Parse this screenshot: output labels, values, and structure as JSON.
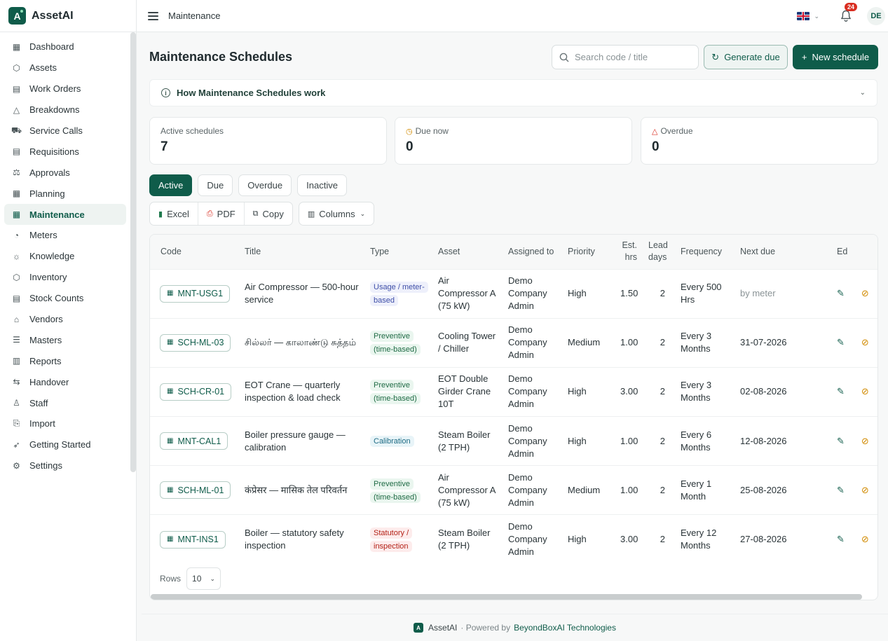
{
  "app": {
    "name": "AssetAI",
    "logo_letter": "A"
  },
  "topbar": {
    "title": "Maintenance",
    "notifications": "24",
    "avatar": "DE",
    "language_icon": "uk-flag-icon"
  },
  "sidebar": {
    "items": [
      {
        "label": "Dashboard",
        "icon": "dashboard-icon",
        "glyph": "▦"
      },
      {
        "label": "Assets",
        "icon": "box-icon",
        "glyph": "⬡"
      },
      {
        "label": "Work Orders",
        "icon": "clipboard-icon",
        "glyph": "▤"
      },
      {
        "label": "Breakdowns",
        "icon": "warning-icon",
        "glyph": "△"
      },
      {
        "label": "Service Calls",
        "icon": "truck-icon",
        "glyph": "⛟"
      },
      {
        "label": "Requisitions",
        "icon": "clipboard-check-icon",
        "glyph": "▤"
      },
      {
        "label": "Approvals",
        "icon": "gavel-icon",
        "glyph": "⚖"
      },
      {
        "label": "Planning",
        "icon": "calendar-icon",
        "glyph": "▦"
      },
      {
        "label": "Maintenance",
        "icon": "calendar-wrench-icon",
        "glyph": "▦"
      },
      {
        "label": "Meters",
        "icon": "gauge-icon",
        "glyph": "◔"
      },
      {
        "label": "Knowledge",
        "icon": "lightbulb-icon",
        "glyph": "☼"
      },
      {
        "label": "Inventory",
        "icon": "boxes-icon",
        "glyph": "⬡"
      },
      {
        "label": "Stock Counts",
        "icon": "clipboard-list-icon",
        "glyph": "▤"
      },
      {
        "label": "Vendors",
        "icon": "store-icon",
        "glyph": "⌂"
      },
      {
        "label": "Masters",
        "icon": "list-icon",
        "glyph": "☰"
      },
      {
        "label": "Reports",
        "icon": "bar-chart-icon",
        "glyph": "▥"
      },
      {
        "label": "Handover",
        "icon": "arrows-icon",
        "glyph": "⇆"
      },
      {
        "label": "Staff",
        "icon": "users-icon",
        "glyph": "♙"
      },
      {
        "label": "Import",
        "icon": "file-import-icon",
        "glyph": "⎘"
      },
      {
        "label": "Getting Started",
        "icon": "rocket-icon",
        "glyph": "➶"
      },
      {
        "label": "Settings",
        "icon": "gear-icon",
        "glyph": "⚙"
      }
    ],
    "active_index": 8
  },
  "page": {
    "title": "Maintenance Schedules",
    "search_placeholder": "Search code / title",
    "generate_label": "Generate due",
    "new_label": "New schedule",
    "howto_label": "How Maintenance Schedules work"
  },
  "stats": [
    {
      "label": "Active schedules",
      "value": "7",
      "icon": "",
      "color": "#5a6467"
    },
    {
      "label": "Due now",
      "value": "0",
      "icon": "◷",
      "color": "#d18a00"
    },
    {
      "label": "Overdue",
      "value": "0",
      "icon": "△",
      "color": "#d92d20"
    }
  ],
  "tabs": [
    "Active",
    "Due",
    "Overdue",
    "Inactive"
  ],
  "active_tab": 0,
  "toolbar": {
    "excel": "Excel",
    "pdf": "PDF",
    "copy": "Copy",
    "columns": "Columns"
  },
  "table": {
    "headers": [
      "Code",
      "Title",
      "Type",
      "Asset",
      "Assigned to",
      "Priority",
      "Est. hrs",
      "Lead days",
      "Frequency",
      "Next due",
      "Ed"
    ],
    "rows": [
      {
        "code": "MNT-USG1",
        "title": "Air Compressor — 500-hour service",
        "type": "Usage / meter-based",
        "type_class": "t-usage",
        "asset": "Air Compressor A (75 kW)",
        "assigned": "Demo Company Admin",
        "priority": "High",
        "est": "1.50",
        "lead": "2",
        "freq": "Every 500 Hrs",
        "next": "by meter",
        "next_muted": true
      },
      {
        "code": "SCH-ML-03",
        "title": "சில்லர் — காலாண்டு சுத்தம்",
        "type": "Preventive (time-based)",
        "type_class": "t-prev",
        "asset": "Cooling Tower / Chiller",
        "assigned": "Demo Company Admin",
        "priority": "Medium",
        "est": "1.00",
        "lead": "2",
        "freq": "Every 3 Months",
        "next": "31-07-2026",
        "next_muted": false
      },
      {
        "code": "SCH-CR-01",
        "title": "EOT Crane — quarterly inspection & load check",
        "type": "Preventive (time-based)",
        "type_class": "t-prev",
        "asset": "EOT Double Girder Crane 10T",
        "assigned": "Demo Company Admin",
        "priority": "High",
        "est": "3.00",
        "lead": "2",
        "freq": "Every 3 Months",
        "next": "02-08-2026",
        "next_muted": false
      },
      {
        "code": "MNT-CAL1",
        "title": "Boiler pressure gauge — calibration",
        "type": "Calibration",
        "type_class": "t-cal",
        "asset": "Steam Boiler (2 TPH)",
        "assigned": "Demo Company Admin",
        "priority": "High",
        "est": "1.00",
        "lead": "2",
        "freq": "Every 6 Months",
        "next": "12-08-2026",
        "next_muted": false
      },
      {
        "code": "SCH-ML-01",
        "title": "कंप्रेसर — मासिक तेल परिवर्तन",
        "type": "Preventive (time-based)",
        "type_class": "t-prev",
        "asset": "Air Compressor A (75 kW)",
        "assigned": "Demo Company Admin",
        "priority": "Medium",
        "est": "1.00",
        "lead": "2",
        "freq": "Every 1 Month",
        "next": "25-08-2026",
        "next_muted": false
      },
      {
        "code": "MNT-INS1",
        "title": "Boiler — statutory safety inspection",
        "type": "Statutory / inspection",
        "type_class": "t-stat",
        "asset": "Steam Boiler (2 TPH)",
        "assigned": "Demo Company Admin",
        "priority": "High",
        "est": "3.00",
        "lead": "2",
        "freq": "Every 12 Months",
        "next": "27-08-2026",
        "next_muted": false
      }
    ],
    "rows_label": "Rows",
    "rows_value": "10"
  },
  "footer": {
    "name": "AssetAI",
    "powered": "· Powered by",
    "company": "BeyondBoxAI Technologies"
  },
  "colors": {
    "brand": "#0f5c4a",
    "danger": "#d92d20",
    "warning": "#d18a00"
  }
}
